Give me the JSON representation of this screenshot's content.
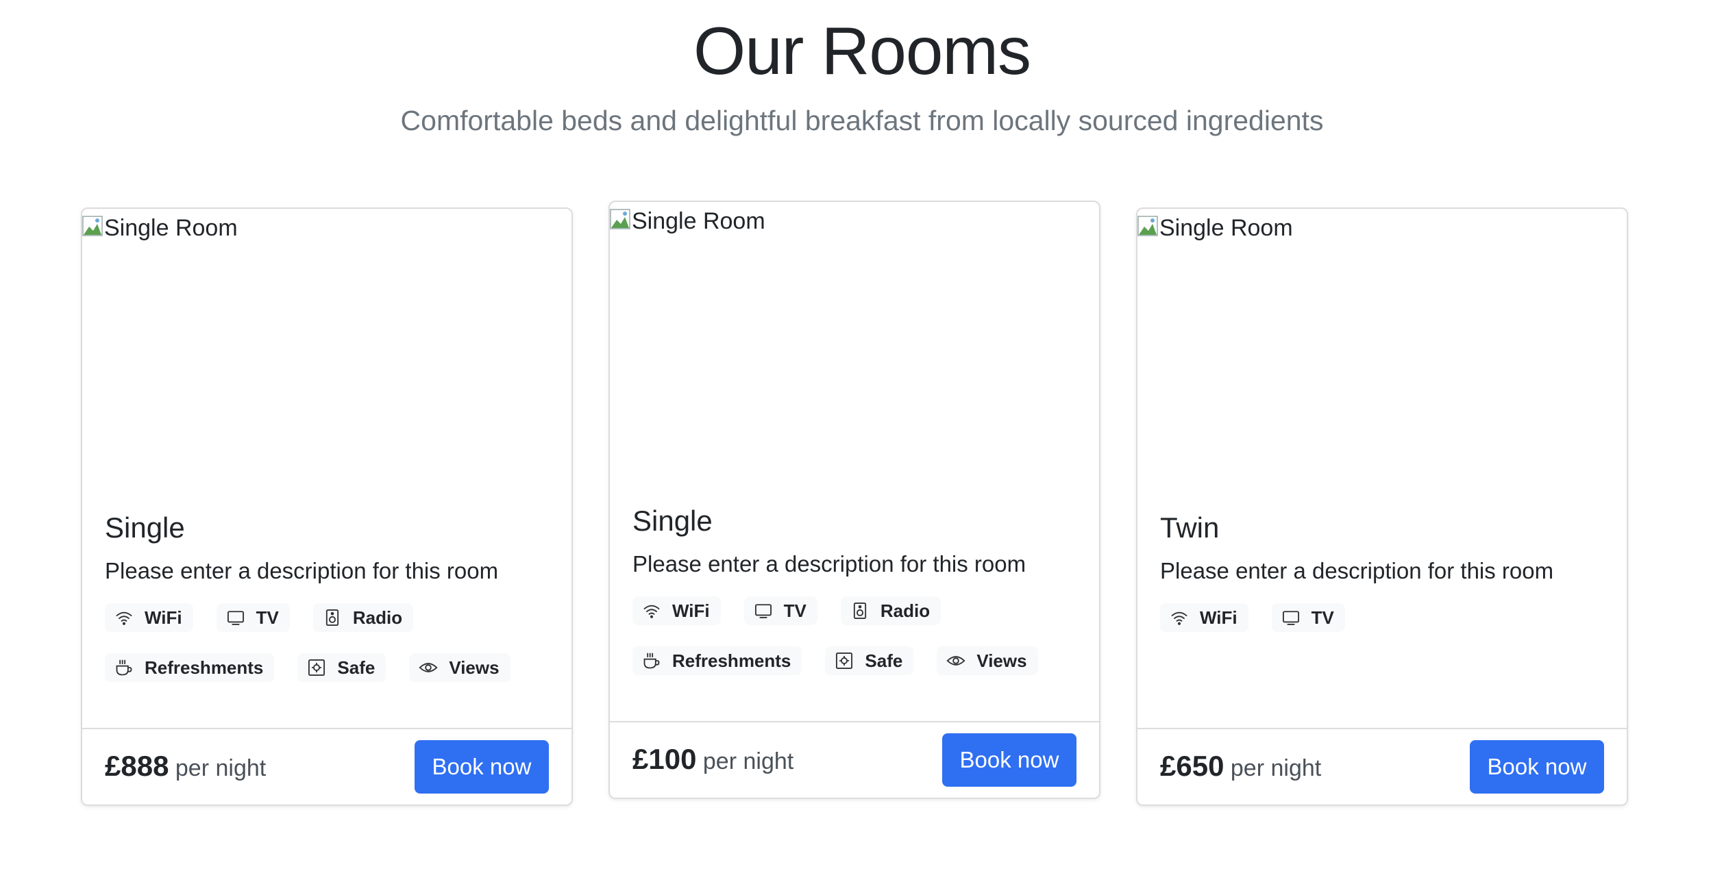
{
  "header": {
    "title": "Our Rooms",
    "subtitle": "Comfortable beds and delightful breakfast from locally sourced ingredients"
  },
  "rooms": [
    {
      "image_alt": "Single Room",
      "type": "Single",
      "description": "Please enter a description for this room",
      "features": [
        {
          "label": "WiFi",
          "icon": "wifi-icon"
        },
        {
          "label": "TV",
          "icon": "tv-icon"
        },
        {
          "label": "Radio",
          "icon": "radio-icon"
        },
        {
          "label": "Refreshments",
          "icon": "cup-icon"
        },
        {
          "label": "Safe",
          "icon": "safe-icon"
        },
        {
          "label": "Views",
          "icon": "eye-icon"
        }
      ],
      "price": "£888",
      "price_suffix": "per night",
      "book_label": "Book now"
    },
    {
      "image_alt": "Single Room",
      "type": "Single",
      "description": "Please enter a description for this room",
      "features": [
        {
          "label": "WiFi",
          "icon": "wifi-icon"
        },
        {
          "label": "TV",
          "icon": "tv-icon"
        },
        {
          "label": "Radio",
          "icon": "radio-icon"
        },
        {
          "label": "Refreshments",
          "icon": "cup-icon"
        },
        {
          "label": "Safe",
          "icon": "safe-icon"
        },
        {
          "label": "Views",
          "icon": "eye-icon"
        }
      ],
      "price": "£100",
      "price_suffix": "per night",
      "book_label": "Book now"
    },
    {
      "image_alt": "Single Room",
      "type": "Twin",
      "description": "Please enter a description for this room",
      "features": [
        {
          "label": "WiFi",
          "icon": "wifi-icon"
        },
        {
          "label": "TV",
          "icon": "tv-icon"
        }
      ],
      "price": "£650",
      "price_suffix": "per night",
      "book_label": "Book now"
    }
  ],
  "colors": {
    "button": "#2f6ff2",
    "chip_bg": "#f8f9fa",
    "subtitle": "#6c757d",
    "border": "#dcdcdc"
  }
}
